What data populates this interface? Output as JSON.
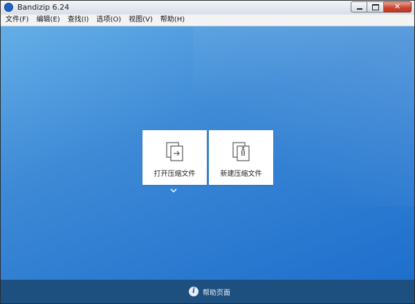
{
  "window": {
    "title": "Bandizip 6.24",
    "close_glyph": "✕"
  },
  "menu": [
    {
      "label": "文件(F)"
    },
    {
      "label": "编辑(E)"
    },
    {
      "label": "查找(I)"
    },
    {
      "label": "选项(O)"
    },
    {
      "label": "视图(V)"
    },
    {
      "label": "帮助(H)"
    }
  ],
  "tiles": {
    "open": {
      "label": "打开压缩文件",
      "icon": "open-archive-icon"
    },
    "new": {
      "label": "新建压缩文件",
      "icon": "new-archive-icon"
    }
  },
  "footer": {
    "help_label": "帮助页面",
    "help_icon_glyph": "i"
  },
  "colors": {
    "accent": "#1e6fcd",
    "footer": "#1d4f7f"
  }
}
